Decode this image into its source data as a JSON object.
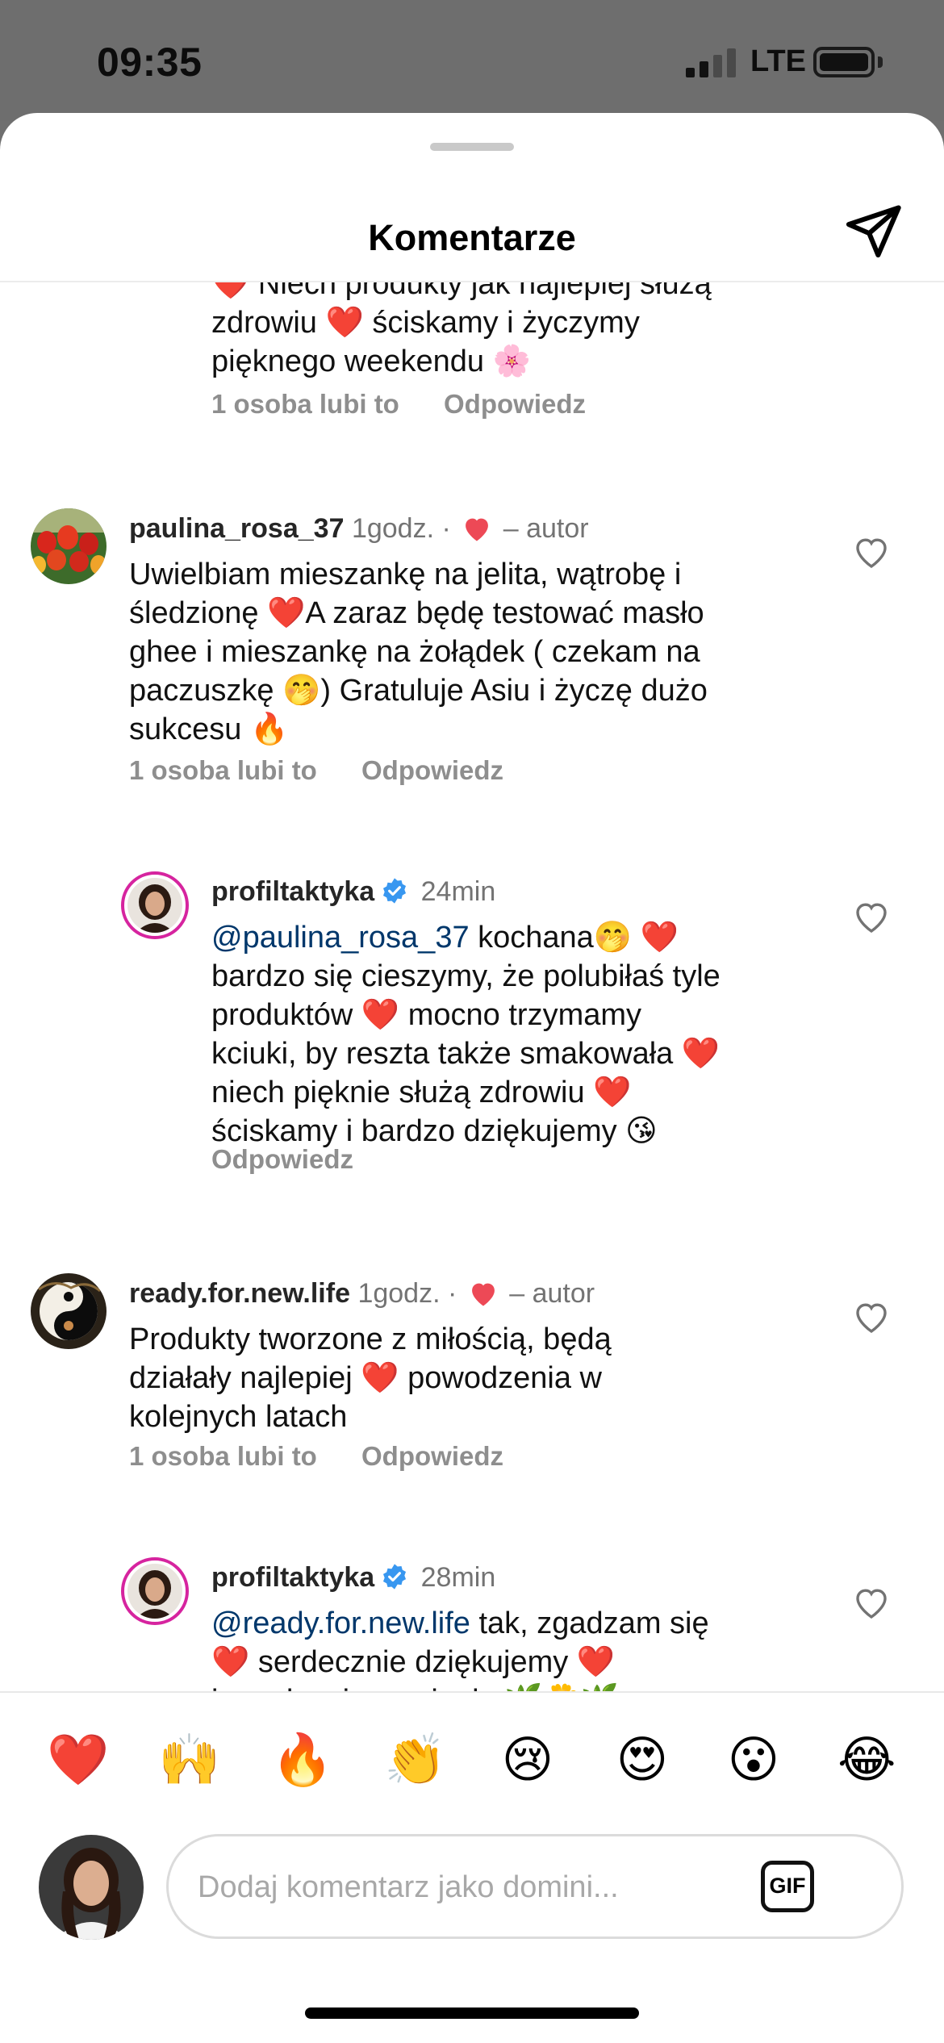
{
  "status_bar": {
    "time": "09:35",
    "network": "LTE"
  },
  "header": {
    "title": "Komentarze"
  },
  "comments": [
    {
      "text_fragment": "❤️ Niech produkty jak najlepiej służą\nzdrowiu ❤️ ściskamy i życzymy\npięknego weekendu 🌸",
      "likes": "1 osoba lubi to",
      "reply": "Odpowiedz"
    },
    {
      "user": "paulina_rosa_37",
      "time": "1godz.",
      "separator": "·",
      "author_like": "– autor",
      "text": "Uwielbiam mieszankę na jelita, wątrobę i\nśledzionę ❤️A zaraz będę testować masło\nghee i mieszankę na żołądek ( czekam na\npaczuszkę 🤭) Gratuluje Asiu i życzę dużo\nsukcesu 🔥",
      "likes": "1 osoba lubi to",
      "reply": "Odpowiedz"
    },
    {
      "user": "profiltaktyka",
      "time": "24min",
      "mention": "@paulina_rosa_37",
      "text": " kochana🤭 ❤️\nbardzo się cieszymy, że polubiłaś tyle\nproduktów ❤️ mocno trzymamy\nkciuki, by reszta także smakowała ❤️\nniech pięknie służą zdrowiu ❤️\nściskamy i bardzo dziękujemy 😘",
      "reply": "Odpowiedz"
    },
    {
      "user": "ready.for.new.life",
      "time": "1godz.",
      "separator": "·",
      "author_like": "– autor",
      "text": "Produkty tworzone z miłością, będą\ndziałały najlepiej ❤️ powodzenia w\nkolejnych latach",
      "likes": "1 osoba lubi to",
      "reply": "Odpowiedz"
    },
    {
      "user": "profiltaktyka",
      "time": "28min",
      "mention": "@ready.for.new.life",
      "text": " tak, zgadzam się\n❤️ serdecznie dziękujemy ❤️\ni pozdrawiamy ciepło 🌿🌼🌿"
    }
  ],
  "emoji_bar": [
    "❤️",
    "🙌",
    "🔥",
    "👏",
    "😢",
    "😍",
    "😮",
    "😂"
  ],
  "composer": {
    "placeholder": "Dodaj komentarz jako domini...",
    "gif_label": "GIF"
  },
  "colors": {
    "like_heart": "#ed4956",
    "mention": "#00376b",
    "verified": "#3897f0",
    "story_ring": "#d6249f"
  }
}
